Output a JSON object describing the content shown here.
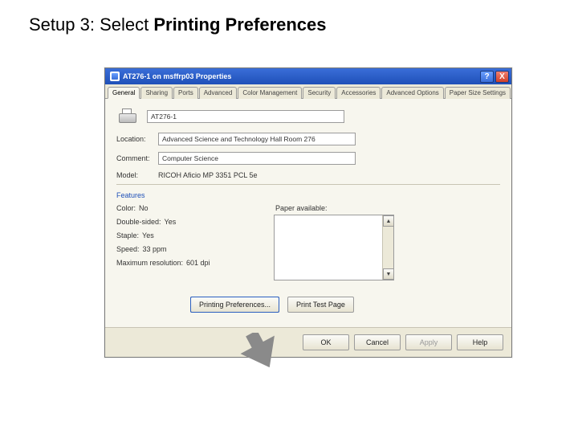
{
  "instruction": {
    "prefix": "Setup 3: Select ",
    "bold": "Printing Preferences"
  },
  "window": {
    "title": "AT276-1 on msffrp03 Properties",
    "help": "?",
    "close": "X"
  },
  "tabs": [
    "General",
    "Sharing",
    "Ports",
    "Advanced",
    "Color Management",
    "Security",
    "Accessories",
    "Advanced Options",
    "Paper Size Settings"
  ],
  "activeTab": 0,
  "fields": {
    "name": "AT276-1",
    "locationLabel": "Location:",
    "location": "Advanced Science and Technology Hall Room 276",
    "commentLabel": "Comment:",
    "comment": "Computer Science",
    "modelLabel": "Model:",
    "model": "RICOH Aficio MP 3351 PCL 5e"
  },
  "features": {
    "title": "Features",
    "color": {
      "k": "Color:",
      "v": "No"
    },
    "duplex": {
      "k": "Double-sided:",
      "v": "Yes"
    },
    "staple": {
      "k": "Staple:",
      "v": "Yes"
    },
    "speed": {
      "k": "Speed:",
      "v": "33 ppm"
    },
    "res": {
      "k": "Maximum resolution:",
      "v": "601 dpi"
    },
    "paperLabel": "Paper available:"
  },
  "buttons": {
    "prefs": "Printing Preferences...",
    "test": "Print Test Page",
    "ok": "OK",
    "cancel": "Cancel",
    "apply": "Apply",
    "helpb": "Help"
  }
}
